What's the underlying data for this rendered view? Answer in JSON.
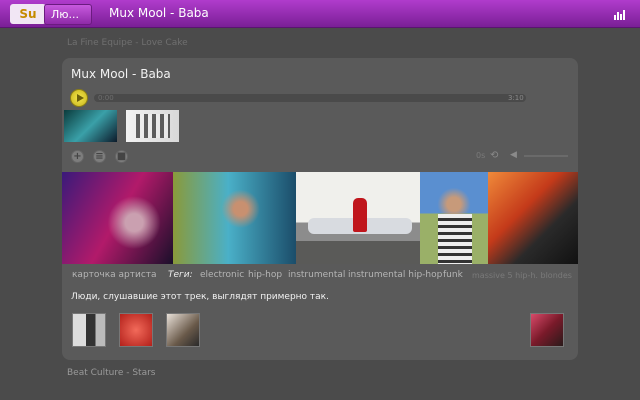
{
  "topbar": {
    "logo": "Su",
    "tab_label": "Лю...",
    "now_playing": "Mux Mool - Baba",
    "icon": "equalizer-icon"
  },
  "previous_track": "La Fine Equipe - Love Cake",
  "next_track": "Beat Culture - Stars",
  "player": {
    "title": "Mux Mool - Baba",
    "elapsed": "0:00",
    "total": "3:10",
    "progress": 0.0,
    "repeat_label": "0s",
    "colors": {
      "accent": "#9b2fb8",
      "play": "#e0cf2c"
    }
  },
  "artist_card_label": "карточка артиста",
  "tags_label": "Теги:",
  "tags": [
    "electronic",
    "hip-hop",
    "instrumental",
    "instrumental hip-hop",
    "funk",
    "massive 5 hip-h. blondes"
  ],
  "similar_heading": "Люди, слушавшие этот трек, выглядят примерно так."
}
